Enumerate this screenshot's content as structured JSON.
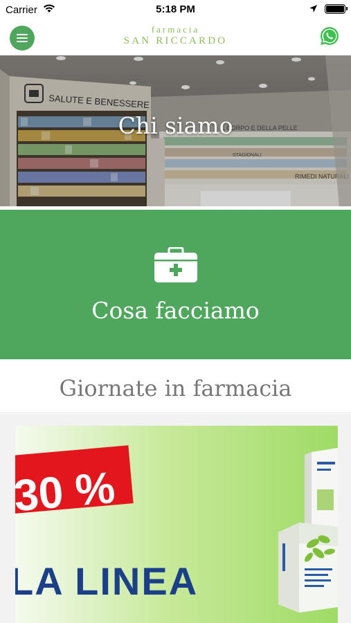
{
  "status_bar": {
    "carrier": "Carrier",
    "time": "5:18 PM"
  },
  "header": {
    "logo_top": "farmacia",
    "logo_bottom": "SAN RICCARDO",
    "menu_icon": "hamburger-menu-icon",
    "contact_icon": "whatsapp-icon"
  },
  "hero": {
    "title": "Chi siamo",
    "photo_signs": [
      "SALUTE E BENESSERE",
      "L CORPO E DELLA PELLE",
      "RIMEDI NATURALI",
      "STAGIONALI"
    ]
  },
  "services": {
    "icon": "first-aid-kit-icon",
    "title": "Cosa facciamo"
  },
  "events": {
    "title": "Giornate in farmacia"
  },
  "promo": {
    "discount": "30 %",
    "headline": "LA LINEA"
  },
  "colors": {
    "brand_green": "#4ea75d",
    "logo_green": "#8dbc5b",
    "promo_red": "#e3161d",
    "promo_blue": "#1c3f8a"
  }
}
